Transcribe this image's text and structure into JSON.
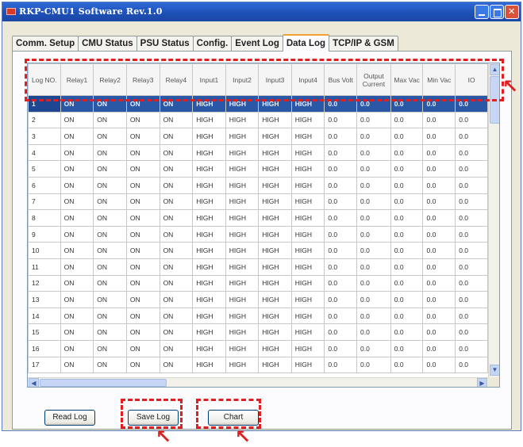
{
  "window": {
    "title": "RKP-CMU1 Software Rev.1.0"
  },
  "tabs": [
    {
      "label": "Comm. Setup",
      "active": false
    },
    {
      "label": "CMU Status",
      "active": false
    },
    {
      "label": "PSU Status",
      "active": false
    },
    {
      "label": "Config.",
      "active": false
    },
    {
      "label": "Event Log",
      "active": false
    },
    {
      "label": "Data Log",
      "active": true
    },
    {
      "label": "TCP/IP & GSM",
      "active": false
    }
  ],
  "grid": {
    "columns": [
      "Log NO.",
      "Relay1",
      "Relay2",
      "Relay3",
      "Relay4",
      "Input1",
      "Input2",
      "Input3",
      "Input4",
      "Bus Volt",
      "Output Current",
      "Max Vac",
      "Min Vac",
      "IO"
    ],
    "rows": [
      [
        "1",
        "ON",
        "ON",
        "ON",
        "ON",
        "HIGH",
        "HIGH",
        "HIGH",
        "HIGH",
        "0.0",
        "0.0",
        "0.0",
        "0.0",
        "0.0"
      ],
      [
        "2",
        "ON",
        "ON",
        "ON",
        "ON",
        "HIGH",
        "HIGH",
        "HIGH",
        "HIGH",
        "0.0",
        "0.0",
        "0.0",
        "0.0",
        "0.0"
      ],
      [
        "3",
        "ON",
        "ON",
        "ON",
        "ON",
        "HIGH",
        "HIGH",
        "HIGH",
        "HIGH",
        "0.0",
        "0.0",
        "0.0",
        "0.0",
        "0.0"
      ],
      [
        "4",
        "ON",
        "ON",
        "ON",
        "ON",
        "HIGH",
        "HIGH",
        "HIGH",
        "HIGH",
        "0.0",
        "0.0",
        "0.0",
        "0.0",
        "0.0"
      ],
      [
        "5",
        "ON",
        "ON",
        "ON",
        "ON",
        "HIGH",
        "HIGH",
        "HIGH",
        "HIGH",
        "0.0",
        "0.0",
        "0.0",
        "0.0",
        "0.0"
      ],
      [
        "6",
        "ON",
        "ON",
        "ON",
        "ON",
        "HIGH",
        "HIGH",
        "HIGH",
        "HIGH",
        "0.0",
        "0.0",
        "0.0",
        "0.0",
        "0.0"
      ],
      [
        "7",
        "ON",
        "ON",
        "ON",
        "ON",
        "HIGH",
        "HIGH",
        "HIGH",
        "HIGH",
        "0.0",
        "0.0",
        "0.0",
        "0.0",
        "0.0"
      ],
      [
        "8",
        "ON",
        "ON",
        "ON",
        "ON",
        "HIGH",
        "HIGH",
        "HIGH",
        "HIGH",
        "0.0",
        "0.0",
        "0.0",
        "0.0",
        "0.0"
      ],
      [
        "9",
        "ON",
        "ON",
        "ON",
        "ON",
        "HIGH",
        "HIGH",
        "HIGH",
        "HIGH",
        "0.0",
        "0.0",
        "0.0",
        "0.0",
        "0.0"
      ],
      [
        "10",
        "ON",
        "ON",
        "ON",
        "ON",
        "HIGH",
        "HIGH",
        "HIGH",
        "HIGH",
        "0.0",
        "0.0",
        "0.0",
        "0.0",
        "0.0"
      ],
      [
        "11",
        "ON",
        "ON",
        "ON",
        "ON",
        "HIGH",
        "HIGH",
        "HIGH",
        "HIGH",
        "0.0",
        "0.0",
        "0.0",
        "0.0",
        "0.0"
      ],
      [
        "12",
        "ON",
        "ON",
        "ON",
        "ON",
        "HIGH",
        "HIGH",
        "HIGH",
        "HIGH",
        "0.0",
        "0.0",
        "0.0",
        "0.0",
        "0.0"
      ],
      [
        "13",
        "ON",
        "ON",
        "ON",
        "ON",
        "HIGH",
        "HIGH",
        "HIGH",
        "HIGH",
        "0.0",
        "0.0",
        "0.0",
        "0.0",
        "0.0"
      ],
      [
        "14",
        "ON",
        "ON",
        "ON",
        "ON",
        "HIGH",
        "HIGH",
        "HIGH",
        "HIGH",
        "0.0",
        "0.0",
        "0.0",
        "0.0",
        "0.0"
      ],
      [
        "15",
        "ON",
        "ON",
        "ON",
        "ON",
        "HIGH",
        "HIGH",
        "HIGH",
        "HIGH",
        "0.0",
        "0.0",
        "0.0",
        "0.0",
        "0.0"
      ],
      [
        "16",
        "ON",
        "ON",
        "ON",
        "ON",
        "HIGH",
        "HIGH",
        "HIGH",
        "HIGH",
        "0.0",
        "0.0",
        "0.0",
        "0.0",
        "0.0"
      ],
      [
        "17",
        "ON",
        "ON",
        "ON",
        "ON",
        "HIGH",
        "HIGH",
        "HIGH",
        "HIGH",
        "0.0",
        "0.0",
        "0.0",
        "0.0",
        "0.0"
      ]
    ],
    "selected_row": 1
  },
  "buttons": {
    "read_log": "Read Log",
    "save_log": "Save Log",
    "chart": "Chart"
  },
  "icons": {
    "app": "app-logo-icon",
    "minimize": "minimize-icon",
    "maximize": "maximize-icon",
    "close": "close-icon",
    "arrow": "arrow-icon"
  },
  "colors": {
    "selection": "#2a57a6",
    "highlight": "#e02020",
    "titlebar": "#1d4fb4",
    "active_tab_accent": "#f0a030"
  }
}
